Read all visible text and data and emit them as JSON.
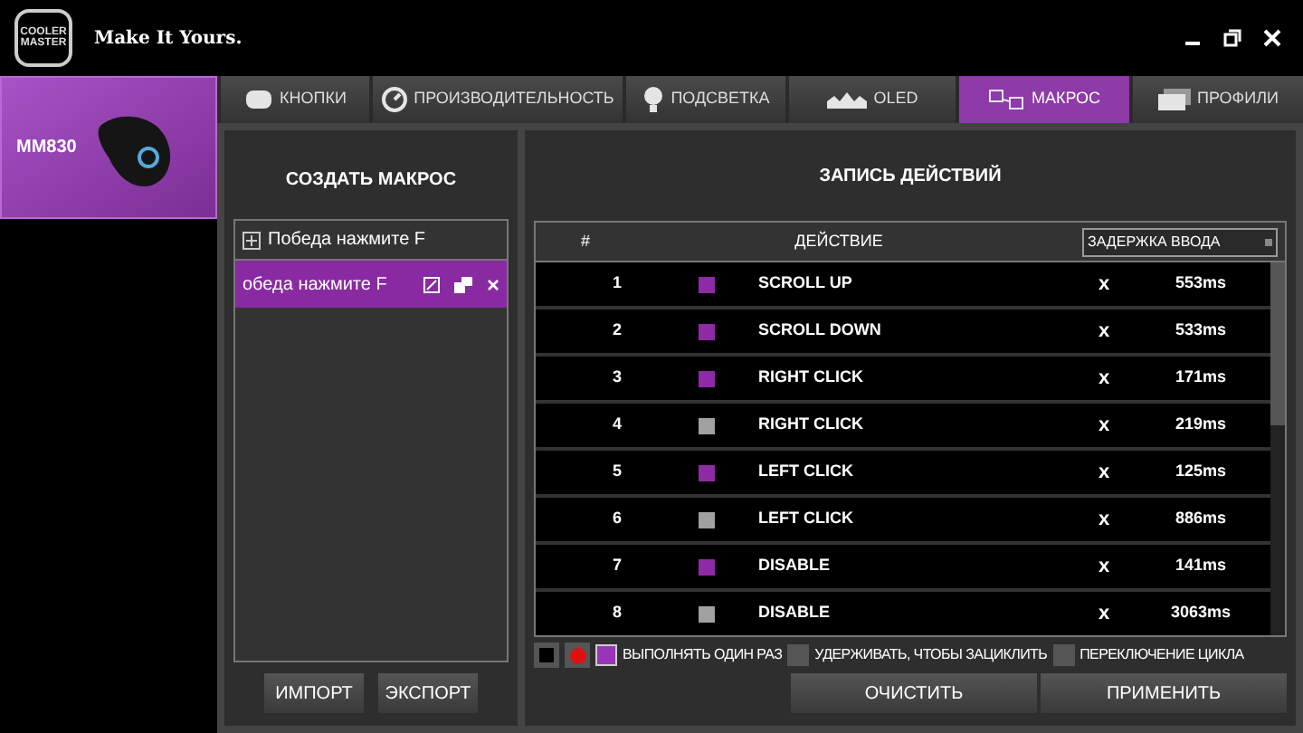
{
  "app": {
    "logo": [
      "COOLER",
      "MASTER"
    ],
    "slogan": "Make It Yours."
  },
  "device": {
    "name": "MM830",
    "selected": true
  },
  "tabs": [
    {
      "label": "КНОПКИ",
      "selected": false
    },
    {
      "label": "ПРОИЗВОДИТЕЛЬНОСТЬ",
      "selected": false
    },
    {
      "label": "ПОДСВЕТКА",
      "selected": false
    },
    {
      "label": "OLED",
      "selected": false
    },
    {
      "label": "МАКРОС",
      "selected": true
    },
    {
      "label": "ПРОФИЛИ",
      "selected": false
    }
  ],
  "macro_panel": {
    "title": "СОЗДАТЬ МАКРОС",
    "new_macro_field": "Победа нажмите F",
    "macros": [
      {
        "name": "обеда нажмите F",
        "selected": true
      }
    ],
    "buttons": [
      "ИМПОРТ",
      "ЭКСПОРТ"
    ]
  },
  "record_panel": {
    "title": "ЗАПИСЬ ДЕЙСТВИЙ",
    "columns": [
      "#",
      "ДЕЙСТВИЕ"
    ],
    "delay_dropdown": "ЗАДЕРЖКА ВВОДА",
    "rows": [
      {
        "index": "1",
        "color": "#8e2aa6",
        "action": "SCROLL UP",
        "delete": "x",
        "delay": "553ms"
      },
      {
        "index": "2",
        "color": "#8e2aa6",
        "action": "SCROLL DOWN",
        "delete": "x",
        "delay": "533ms"
      },
      {
        "index": "3",
        "color": "#8e2aa6",
        "action": "RIGHT CLICK",
        "delete": "x",
        "delay": "171ms"
      },
      {
        "index": "4",
        "color": "#a0a0a0",
        "action": "RIGHT CLICK",
        "delete": "x",
        "delay": "219ms"
      },
      {
        "index": "5",
        "color": "#8e2aa6",
        "action": "LEFT CLICK",
        "delete": "x",
        "delay": "125ms"
      },
      {
        "index": "6",
        "color": "#a0a0a0",
        "action": "LEFT CLICK",
        "delete": "x",
        "delay": "886ms"
      },
      {
        "index": "7",
        "color": "#8e2aa6",
        "action": "DISABLE",
        "delete": "x",
        "delay": "141ms"
      },
      {
        "index": "8",
        "color": "#a0a0a0",
        "action": "DISABLE",
        "delete": "x",
        "delay": "3063ms"
      }
    ],
    "repeat_options": [
      {
        "label": "ВЫПОЛНЯТЬ ОДИН РАЗ",
        "selected": true
      },
      {
        "label": "УДЕРЖИВАТЬ, ЧТОБЫ ЗАЦИКЛИТЬ",
        "selected": false
      },
      {
        "label": "ПЕРЕКЛЮЧЕНИЕ ЦИКЛА",
        "selected": false
      }
    ],
    "buttons": [
      "ОЧИСТИТЬ",
      "ПРИМЕНИТЬ"
    ]
  }
}
